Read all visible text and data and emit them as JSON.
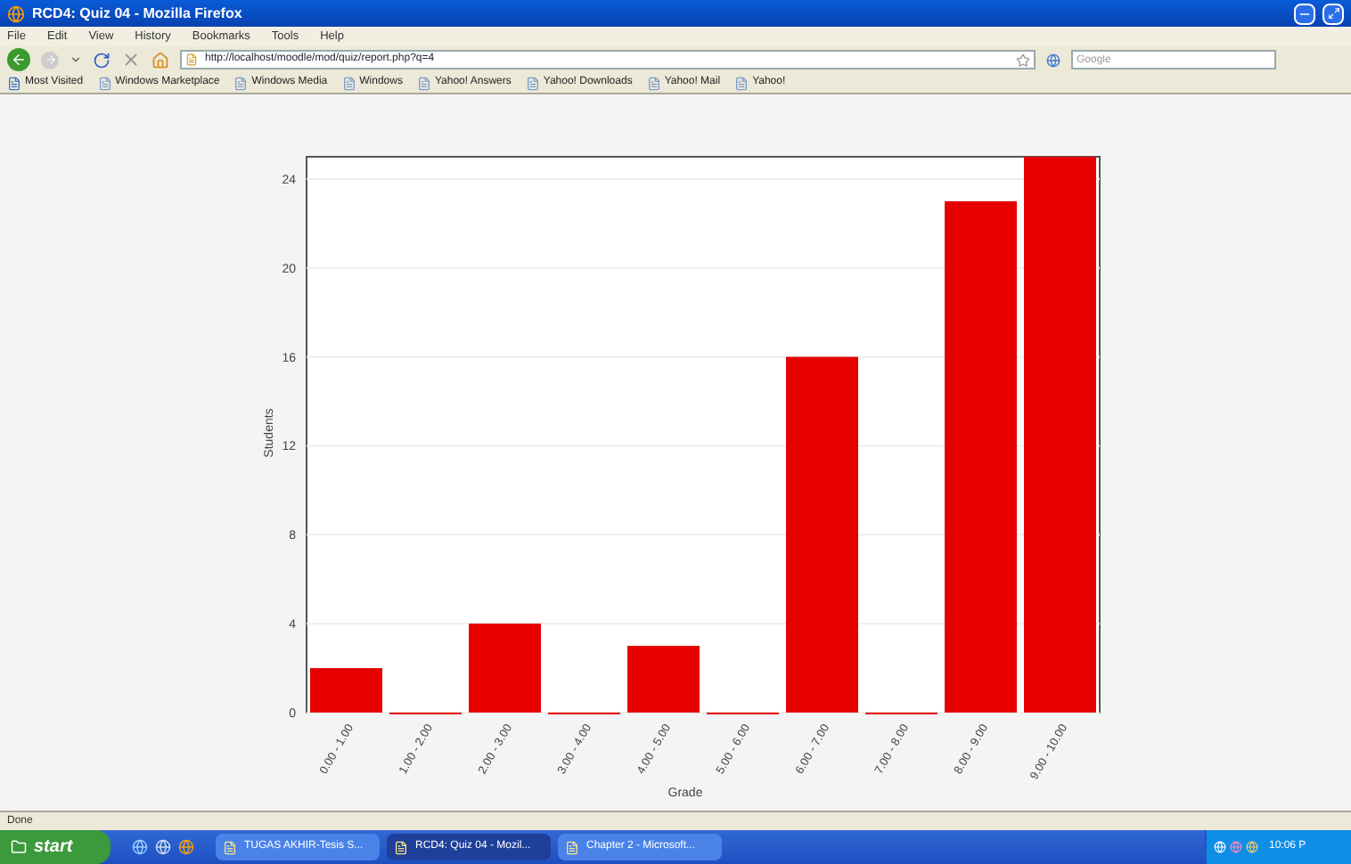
{
  "window": {
    "title": "RCD4: Quiz 04 - Mozilla Firefox"
  },
  "menu": [
    "File",
    "Edit",
    "View",
    "History",
    "Bookmarks",
    "Tools",
    "Help"
  ],
  "address_bar": {
    "value": "http://localhost/moodle/mod/quiz/report.php?q=4"
  },
  "search": {
    "placeholder": "Google"
  },
  "bookmarks": [
    "Most Visited",
    "Windows Marketplace",
    "Windows Media",
    "Windows",
    "Yahoo! Answers",
    "Yahoo! Downloads",
    "Yahoo! Mail",
    "Yahoo!"
  ],
  "chart_data": {
    "type": "bar",
    "xlabel": "Grade",
    "ylabel": "Students",
    "categories": [
      "0.00 - 1.00",
      "1.00 - 2.00",
      "2.00 - 3.00",
      "3.00 - 4.00",
      "4.00 - 5.00",
      "5.00 - 6.00",
      "6.00 - 7.00",
      "7.00 - 8.00",
      "8.00 - 9.00",
      "9.00 - 10.00"
    ],
    "values": [
      2,
      0,
      4,
      0,
      3,
      0,
      16,
      0,
      23,
      25
    ],
    "ylim": [
      0,
      25
    ],
    "grid": true,
    "yticks": [
      0,
      4,
      8,
      12,
      16,
      20,
      24
    ]
  },
  "status_bar": {
    "text": "Done"
  },
  "taskbar": {
    "start": "start",
    "tasks": [
      {
        "label": "TUGAS AKHIR-Tesis S...",
        "selected": false
      },
      {
        "label": "RCD4: Quiz 04 - Mozil...",
        "selected": true
      },
      {
        "label": "Chapter 2 - Microsoft...",
        "selected": false
      }
    ],
    "clock": "10:06 P"
  }
}
